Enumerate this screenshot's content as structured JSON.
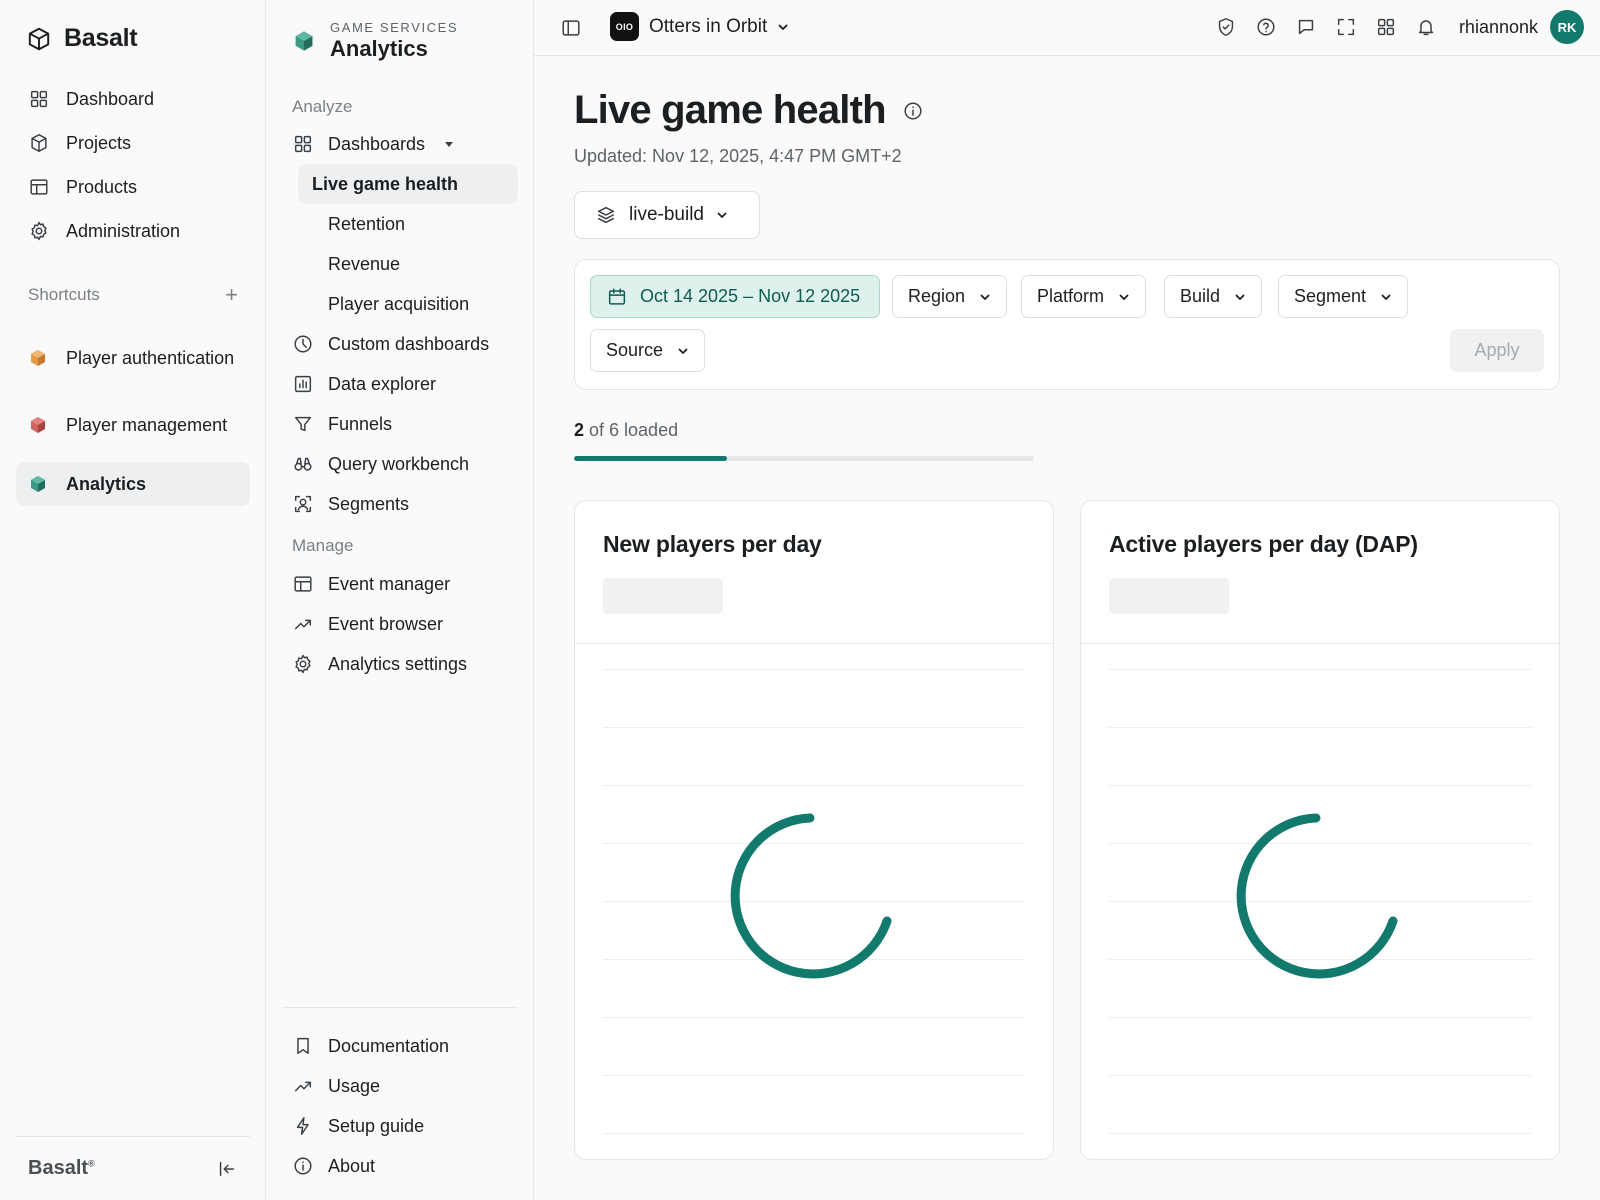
{
  "brand": {
    "name": "Basalt",
    "footer_name": "Basalt",
    "icon": "cube-outline-icon"
  },
  "main_nav": [
    {
      "label": "Dashboard",
      "icon": "grid-icon"
    },
    {
      "label": "Projects",
      "icon": "cube-icon"
    },
    {
      "label": "Products",
      "icon": "layout-icon"
    },
    {
      "label": "Administration",
      "icon": "gear-icon"
    }
  ],
  "shortcuts": {
    "heading": "Shortcuts",
    "items": [
      {
        "label": "Player authentication",
        "color": "#d98a3a"
      },
      {
        "label": "Player management",
        "color": "#c0544e"
      },
      {
        "label": "Analytics",
        "color": "#2f8c78",
        "active": true
      }
    ]
  },
  "service": {
    "kicker": "GAME SERVICES",
    "title": "Analytics"
  },
  "analyze": {
    "heading": "Analyze",
    "dashboards_label": "Dashboards",
    "dashboards": [
      "Live game health",
      "Retention",
      "Revenue",
      "Player acquisition"
    ],
    "items": [
      {
        "label": "Custom dashboards",
        "icon": "clock-icon"
      },
      {
        "label": "Data explorer",
        "icon": "bar-chart-icon"
      },
      {
        "label": "Funnels",
        "icon": "funnel-icon"
      },
      {
        "label": "Query workbench",
        "icon": "binoculars-icon"
      },
      {
        "label": "Segments",
        "icon": "user-focus-icon"
      }
    ]
  },
  "manage": {
    "heading": "Manage",
    "items": [
      {
        "label": "Event manager",
        "icon": "table-icon"
      },
      {
        "label": "Event browser",
        "icon": "trend-icon"
      },
      {
        "label": "Analytics settings",
        "icon": "gear-icon"
      }
    ]
  },
  "bottom_links": [
    {
      "label": "Documentation",
      "icon": "bookmark-icon"
    },
    {
      "label": "Usage",
      "icon": "trend-icon"
    },
    {
      "label": "Setup guide",
      "icon": "bolt-icon"
    },
    {
      "label": "About",
      "icon": "info-icon"
    }
  ],
  "topbar": {
    "project_badge": "OIO",
    "project_name": "Otters in Orbit",
    "username": "rhiannonk",
    "avatar_initials": "RK",
    "icons": [
      "shield-check-icon",
      "help-icon",
      "chat-icon",
      "fullscreen-icon",
      "apps-icon",
      "bell-icon"
    ]
  },
  "page": {
    "title": "Live game health",
    "updated": "Updated: Nov 12, 2025, 4:47 PM GMT+2",
    "environment": "live-build",
    "filters": {
      "date_range": "Oct 14 2025 – Nov 12 2025",
      "buttons": [
        "Region",
        "Platform",
        "Build",
        "Segment",
        "Source"
      ],
      "apply_label": "Apply"
    },
    "loading": {
      "loaded": "2",
      "text": " of 6 loaded",
      "loaded_count": 2,
      "total_count": 6
    },
    "cards": [
      {
        "title": "New players per day",
        "state": "loading"
      },
      {
        "title": "Active players per day (DAP)",
        "state": "loading"
      }
    ]
  },
  "colors": {
    "accent": "#117a6c",
    "date_chip_bg": "#dff1ec"
  }
}
